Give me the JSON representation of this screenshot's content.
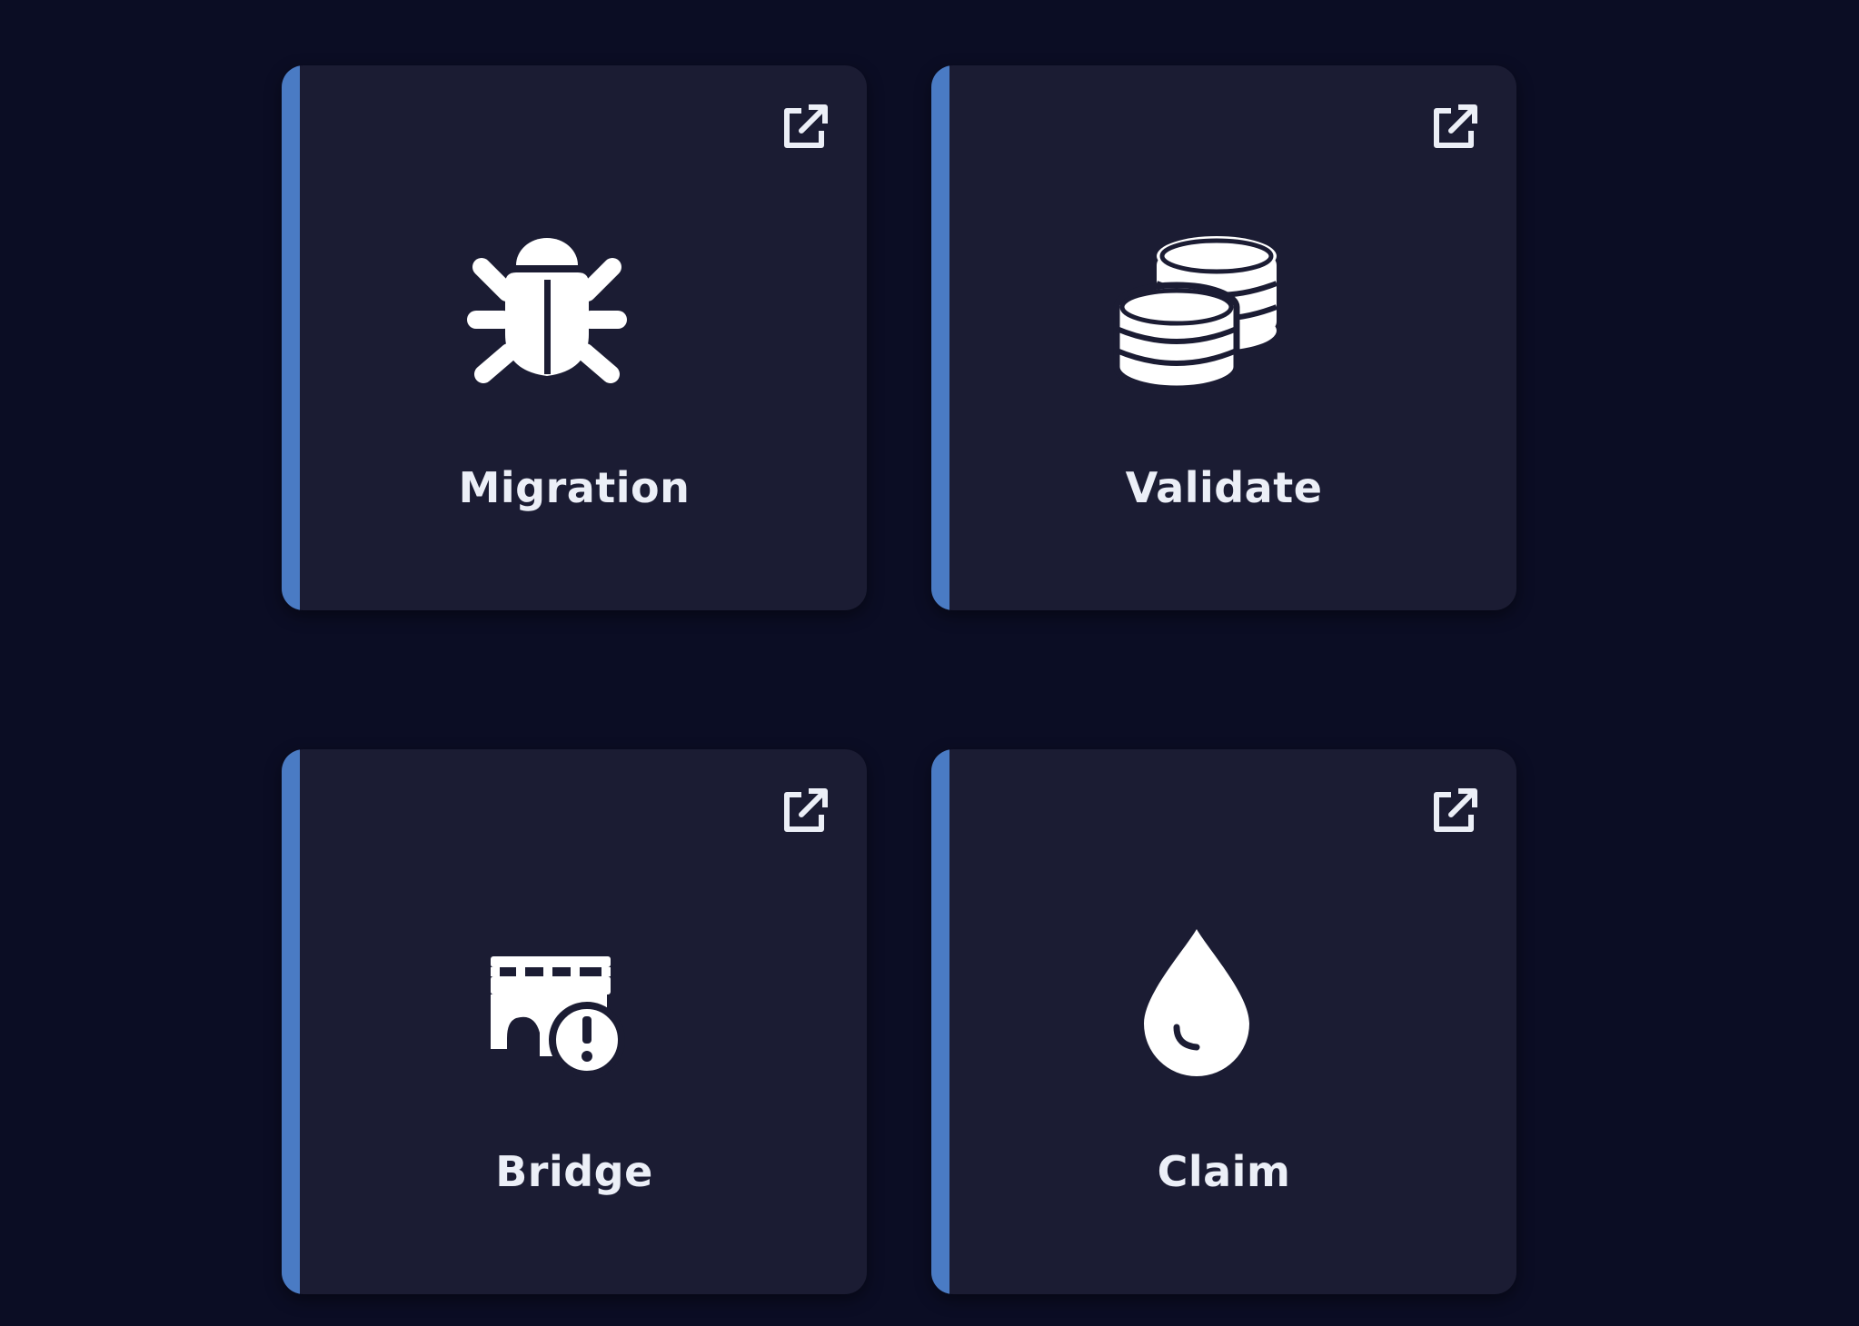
{
  "colors": {
    "background": "#0b0d24",
    "card": "#1b1c33",
    "accent": "#4a7bc4",
    "text": "#eceff7"
  },
  "cards": [
    {
      "label": "Migration",
      "icon": "bug-icon",
      "action_icon": "external-link-icon"
    },
    {
      "label": "Validate",
      "icon": "coins-icon",
      "action_icon": "external-link-icon"
    },
    {
      "label": "Bridge",
      "icon": "bridge-warning-icon",
      "action_icon": "external-link-icon"
    },
    {
      "label": "Claim",
      "icon": "droplet-icon",
      "action_icon": "external-link-icon"
    }
  ]
}
